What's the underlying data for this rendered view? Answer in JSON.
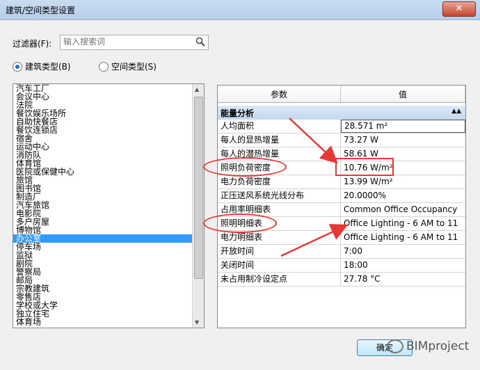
{
  "window": {
    "title": "建筑/空间类型设置",
    "close_glyph": "✕"
  },
  "filter": {
    "label": "过滤器(F):",
    "placeholder": "输入搜索词"
  },
  "radios": [
    {
      "label": "建筑类型(B)",
      "checked": true
    },
    {
      "label": "空间类型(S)",
      "checked": false
    }
  ],
  "list": {
    "items": [
      "汽车工厂",
      "会议中心",
      "法院",
      "餐饮娱乐场所",
      "自助快餐店",
      "餐饮连锁店",
      "宿舍",
      "运动中心",
      "消防队",
      "体育馆",
      "医院或保健中心",
      "旅馆",
      "图书馆",
      "制造厂",
      "汽车旅馆",
      "电影院",
      "多户房屋",
      "博物馆",
      "办公室",
      "停车场",
      "监狱",
      "剧院",
      "警察局",
      "邮局",
      "宗教建筑",
      "零售店",
      "学校或大学",
      "独立住宅",
      "体育场"
    ],
    "selected_index": 18
  },
  "grid": {
    "col_param": "参数",
    "col_value": "值",
    "group": "能量分析",
    "rows": [
      {
        "key": "人均面积",
        "value": "28.571 m²"
      },
      {
        "key": "每人的显热增量",
        "value": "73.27 W"
      },
      {
        "key": "每人的潜热增量",
        "value": "58.61 W"
      },
      {
        "key": "照明负荷密度",
        "value": "10.76 W/m²"
      },
      {
        "key": "电力负荷密度",
        "value": "13.99 W/m²"
      },
      {
        "key": "正压送风系统光线分布",
        "value": "20.0000%"
      },
      {
        "key": "占用率明细表",
        "value": "Common Office Occupancy"
      },
      {
        "key": "照明明细表",
        "value": "Office Lighting - 6 AM to 11"
      },
      {
        "key": "电力明细表",
        "value": "Office Lighting - 6 AM to 11"
      },
      {
        "key": "开放时间",
        "value": "7:00"
      },
      {
        "key": "关闭时间",
        "value": "18:00"
      },
      {
        "key": "未占用制冷设定点",
        "value": "27.78 °C"
      }
    ]
  },
  "ok_button": "确定",
  "watermark": "BIMproject",
  "colors": {
    "annotation": "#e53935",
    "selection": "#3399ff"
  }
}
